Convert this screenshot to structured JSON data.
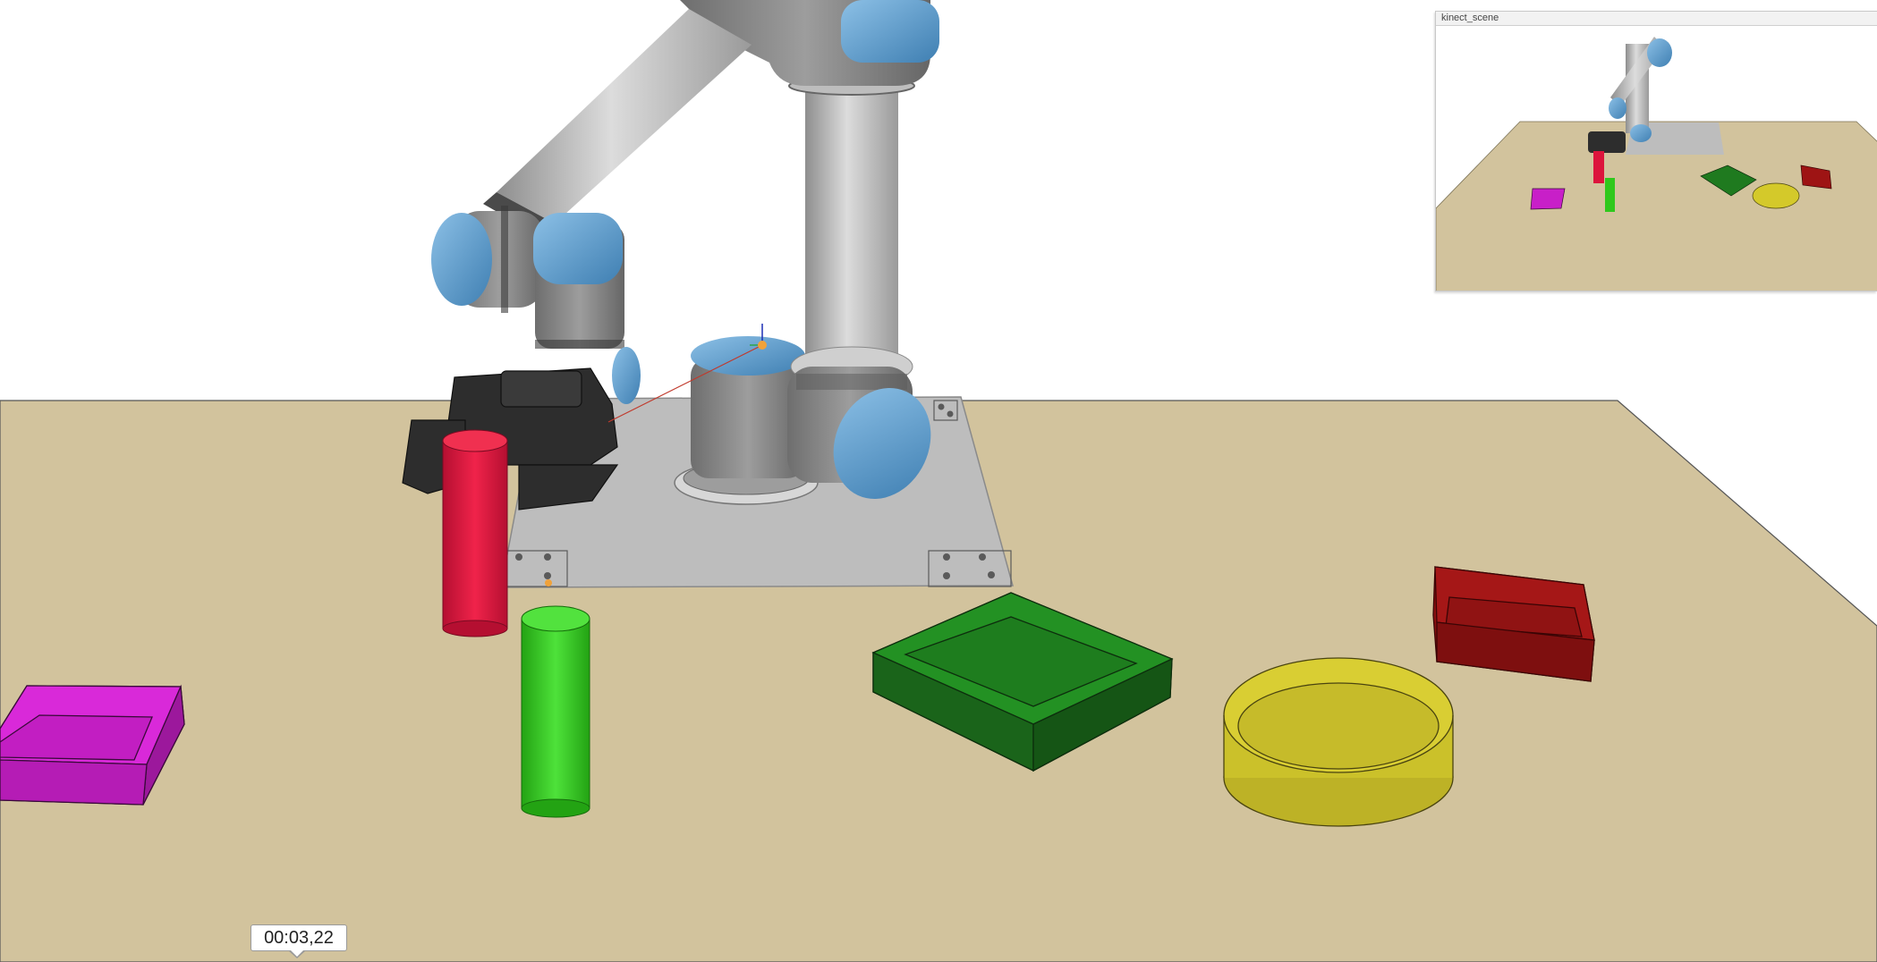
{
  "inset": {
    "title": "kinect_scene"
  },
  "timer": {
    "value": "00:03,22"
  },
  "colors": {
    "background": "#ffffff",
    "table": "#d2c39d",
    "robot_base_plate": "#bdbdbd",
    "robot_link_gray": "#bdbdbd",
    "robot_joint_blue": "#5f9dcb",
    "gripper": "#2d2d2d",
    "red_cylinder": "#dc143c",
    "green_cylinder": "#2fc81c",
    "magenta_box": "#c81fc8",
    "green_box": "#1f7a1f",
    "yellow_bowl": "#d4c92a",
    "red_box": "#9e1414"
  },
  "scene_objects": [
    {
      "name": "red-cylinder",
      "color": "red"
    },
    {
      "name": "green-cylinder",
      "color": "green"
    },
    {
      "name": "magenta-box",
      "color": "magenta"
    },
    {
      "name": "green-box",
      "color": "green"
    },
    {
      "name": "yellow-bowl",
      "color": "yellow"
    },
    {
      "name": "red-box",
      "color": "red"
    }
  ]
}
